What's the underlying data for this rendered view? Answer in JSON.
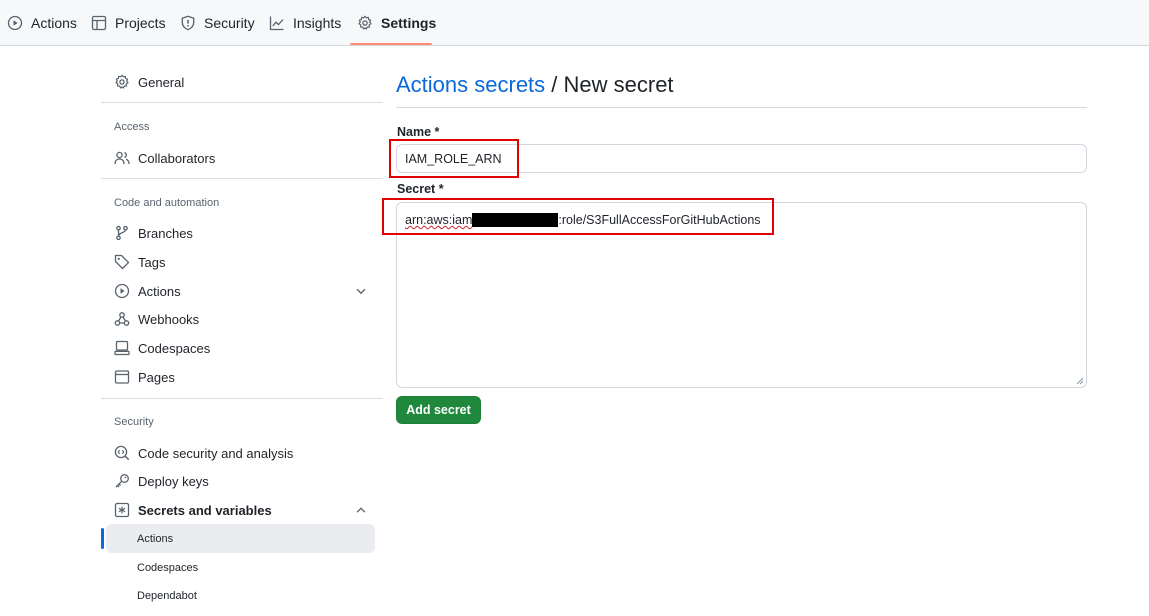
{
  "colors": {
    "accent": "#0969da",
    "button": "#1f883d",
    "highlight": "#e00000",
    "tab_underline": "#fd8c73"
  },
  "topnav": {
    "tabs": [
      {
        "label": "Actions",
        "icon": "play-circle-icon"
      },
      {
        "label": "Projects",
        "icon": "table-icon"
      },
      {
        "label": "Security",
        "icon": "shield-icon"
      },
      {
        "label": "Insights",
        "icon": "graph-icon"
      },
      {
        "label": "Settings",
        "icon": "gear-icon",
        "selected": true
      }
    ]
  },
  "sidebar": {
    "general": "General",
    "access_heading": "Access",
    "collaborators": "Collaborators",
    "code_heading": "Code and automation",
    "branches": "Branches",
    "tags": "Tags",
    "actions": "Actions",
    "webhooks": "Webhooks",
    "codespaces": "Codespaces",
    "pages": "Pages",
    "security_heading": "Security",
    "code_security": "Code security and analysis",
    "deploy_keys": "Deploy keys",
    "secrets_variables": "Secrets and variables",
    "sub_items": [
      "Actions",
      "Codespaces",
      "Dependabot"
    ],
    "active_sub_item": "Actions"
  },
  "main": {
    "breadcrumb_link": "Actions secrets",
    "breadcrumb_separator": " / ",
    "page_title": "New secret",
    "name_label": "Name *",
    "name_value": "IAM_ROLE_ARN",
    "secret_label": "Secret *",
    "secret_prefix": "arn:aws:iam",
    "secret_suffix": ":role/S3FullAccessForGitHubActions",
    "add_button": "Add secret"
  }
}
